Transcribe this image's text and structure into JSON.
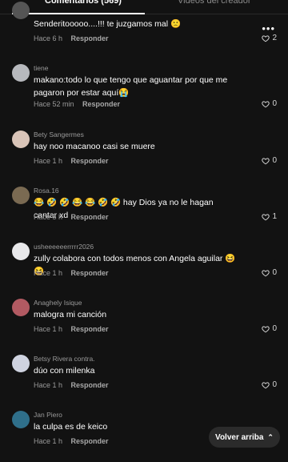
{
  "tabs": {
    "comments": "Comentarios (569)",
    "creator_videos": "Videos del creador"
  },
  "reply_label": "Responder",
  "comments": [
    {
      "username": "",
      "text": "Senderitooooo....!!! te juzgamos mal 🙁",
      "time": "Hace 6 h",
      "likes": "2",
      "avatar_color": "#555555"
    },
    {
      "username": "tiene",
      "text": "makano:todo lo que tengo que aguantar por que me pagaron por estar aquí😭",
      "time": "Hace 52 min",
      "likes": "0",
      "avatar_color": "#b7b9bd"
    },
    {
      "username": "Bety Sangermes",
      "text": "hay noo macanoo casi se muere",
      "time": "Hace 1 h",
      "likes": "0",
      "avatar_color": "#d9c4b8"
    },
    {
      "username": "Rosa.16",
      "text": "😂 🤣 🤣 😂 😂 🤣 🤣  hay Dios ya no le hagan cantar xd",
      "time": "Hace 5 h",
      "likes": "1",
      "avatar_color": "#7a6a52"
    },
    {
      "username": "usheeeeeerrrrr2026",
      "text": "zully colabora con todos menos con Angela aguilar 😆 😆",
      "time": "Hace 1 h",
      "likes": "0",
      "avatar_color": "#e8e8ea"
    },
    {
      "username": "Anaghely Isique",
      "text": "malogra mi canción",
      "time": "Hace 1 h",
      "likes": "0",
      "avatar_color": "#b25a62"
    },
    {
      "username": "Betsy Rivera contra.",
      "text": "dúo con milenka",
      "time": "Hace 1 h",
      "likes": "0",
      "avatar_color": "#cfd3e0"
    },
    {
      "username": "Jan Piero",
      "text": "la culpa es de keico",
      "time": "Hace 1 h",
      "likes": "",
      "avatar_color": "#2f6f8a"
    }
  ],
  "back_to_top": "Volver arriba",
  "icons": {
    "like": "heart-outline-icon",
    "more": "more-options-icon",
    "back": "chevron-up-double-icon"
  }
}
